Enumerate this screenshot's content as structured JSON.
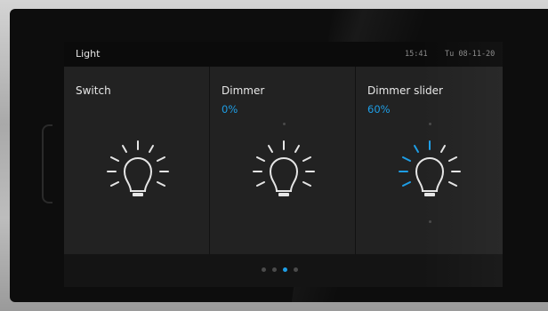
{
  "header": {
    "title": "Light",
    "time": "15:41",
    "date": "Tu 08-11-20"
  },
  "tiles": [
    {
      "label": "Switch",
      "value": "",
      "state": "off"
    },
    {
      "label": "Dimmer",
      "value": "0%",
      "level": 0
    },
    {
      "label": "Dimmer slider",
      "value": "60%",
      "level": 0.6
    }
  ],
  "pager": {
    "pages": 4,
    "active_index": 2
  },
  "colors": {
    "accent": "#1e9ee6",
    "background": "#1c1c1c",
    "text": "#e8e8e8"
  },
  "icons": [
    "light-bulb-icon"
  ]
}
